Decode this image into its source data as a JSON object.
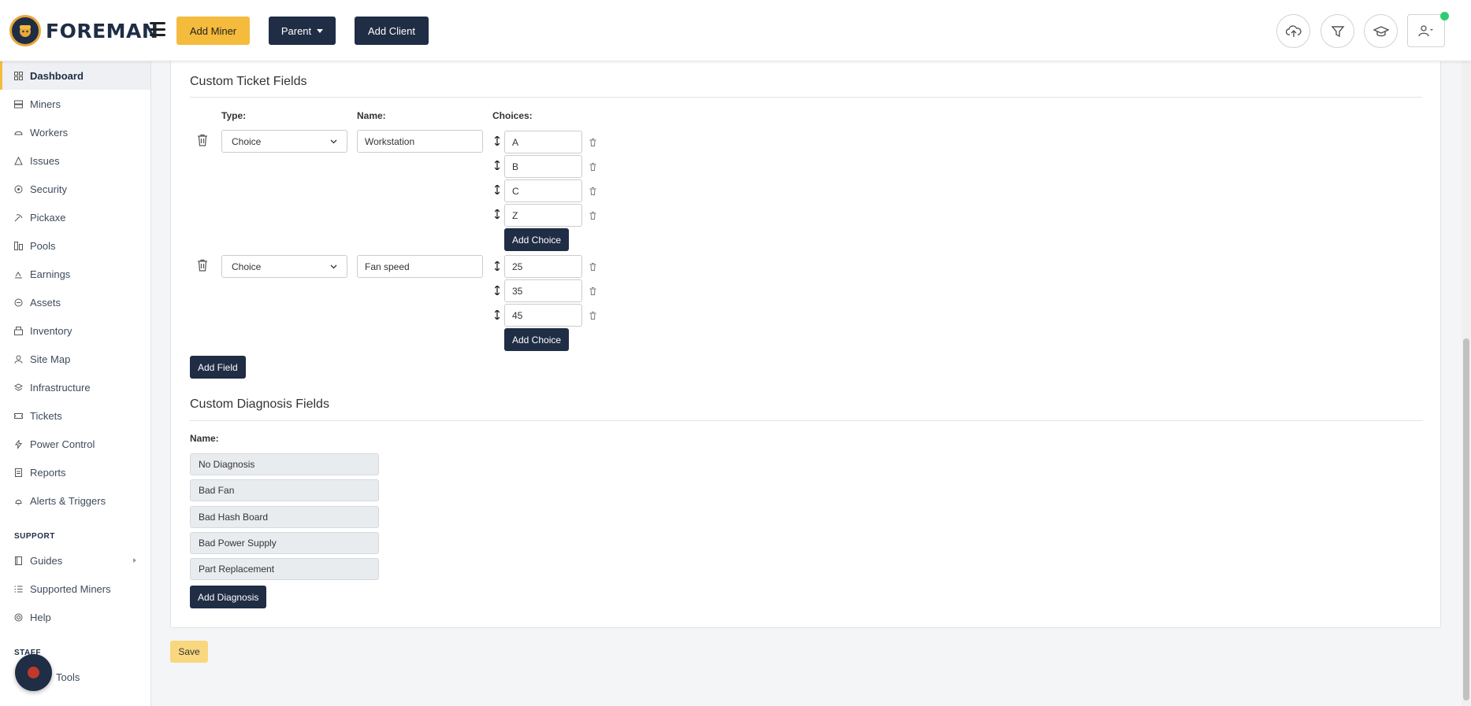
{
  "header": {
    "logo_text": "FOREMAN",
    "add_miner_label": "Add Miner",
    "parent_label": "Parent",
    "add_client_label": "Add Client"
  },
  "sidebar": {
    "items": [
      {
        "label": "Dashboard",
        "icon": "dashboard-icon"
      },
      {
        "label": "Miners",
        "icon": "miners-icon"
      },
      {
        "label": "Workers",
        "icon": "workers-icon"
      },
      {
        "label": "Issues",
        "icon": "warning-icon"
      },
      {
        "label": "Security",
        "icon": "shield-icon"
      },
      {
        "label": "Pickaxe",
        "icon": "pickaxe-icon"
      },
      {
        "label": "Pools",
        "icon": "pools-icon"
      },
      {
        "label": "Earnings",
        "icon": "earnings-icon"
      },
      {
        "label": "Assets",
        "icon": "assets-icon"
      },
      {
        "label": "Inventory",
        "icon": "inventory-icon"
      },
      {
        "label": "Site Map",
        "icon": "site-map-icon"
      },
      {
        "label": "Infrastructure",
        "icon": "layers-icon"
      },
      {
        "label": "Tickets",
        "icon": "ticket-icon"
      },
      {
        "label": "Power Control",
        "icon": "power-icon"
      },
      {
        "label": "Reports",
        "icon": "reports-icon"
      },
      {
        "label": "Alerts & Triggers",
        "icon": "alert-icon"
      }
    ],
    "support_label": "SUPPORT",
    "support_items": [
      {
        "label": "Guides",
        "icon": "guides-icon"
      },
      {
        "label": "Supported Miners",
        "icon": "list-icon"
      },
      {
        "label": "Help",
        "icon": "help-icon"
      }
    ],
    "staff_label": "STAFF",
    "staff_items": [
      {
        "label": "Tools",
        "icon": "tools-icon"
      }
    ]
  },
  "ticket_fields": {
    "title": "Custom Ticket Fields",
    "type_label": "Type:",
    "name_label": "Name:",
    "choices_label": "Choices:",
    "fields": [
      {
        "type": "Choice",
        "name": "Workstation",
        "choices": [
          "A",
          "B",
          "C",
          "Z"
        ]
      },
      {
        "type": "Choice",
        "name": "Fan speed",
        "choices": [
          "25",
          "35",
          "45"
        ]
      }
    ],
    "add_choice_label": "Add Choice",
    "add_field_label": "Add Field"
  },
  "diagnosis_fields": {
    "title": "Custom Diagnosis Fields",
    "name_label": "Name:",
    "items": [
      "No Diagnosis",
      "Bad Fan",
      "Bad Hash Board",
      "Bad Power Supply",
      "Part Replacement"
    ],
    "add_diagnosis_label": "Add Diagnosis"
  },
  "save_label": "Save",
  "colors": {
    "brand_dark": "#1f2d45",
    "brand_yellow": "#f4bb3c",
    "online": "#2ecc71"
  }
}
